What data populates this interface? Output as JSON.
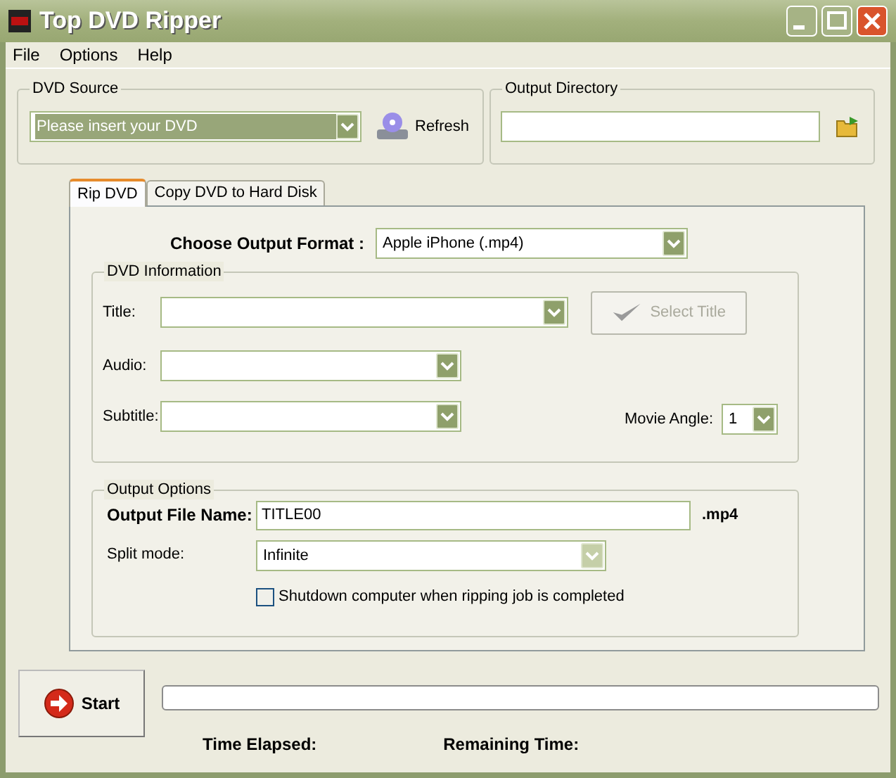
{
  "window": {
    "title": "Top DVD Ripper"
  },
  "menu": [
    {
      "label": "File"
    },
    {
      "label": "Options"
    },
    {
      "label": "Help"
    }
  ],
  "dvd_source": {
    "label": "DVD Source",
    "value": "Please insert your DVD",
    "refresh": "Refresh"
  },
  "output_directory": {
    "label": "Output Directory"
  },
  "tabs": [
    {
      "label": "Rip DVD",
      "selected": true
    },
    {
      "label": "Copy DVD to Hard Disk",
      "selected": false
    }
  ],
  "output_format": {
    "label": "Choose Output Format :",
    "value": "Apple iPhone (.mp4)"
  },
  "dvd_information": {
    "label": "DVD Information",
    "fields": [
      {
        "label": "Title:"
      },
      {
        "label": "Audio:"
      },
      {
        "label": "Subtitle:"
      }
    ],
    "select_title": {
      "label": "Select Title",
      "disabled": true
    },
    "movie_angle": {
      "label": "Movie Angle:",
      "value": "1"
    }
  },
  "output_options": {
    "label": "Output Options",
    "file_name": {
      "label": "Output File Name:",
      "value": "TITLE00",
      "extension": ".mp4"
    },
    "split_mode": {
      "label": "Split mode:",
      "value": "Infinite"
    },
    "shutdown": {
      "label": "Shutdown computer when ripping job is completed",
      "checked": false
    }
  },
  "start_button": {
    "label": "Start"
  },
  "progress": {
    "level": 0
  },
  "time_elapsed": "Time Elapsed:",
  "remaining_time": "Remaining Time:"
}
